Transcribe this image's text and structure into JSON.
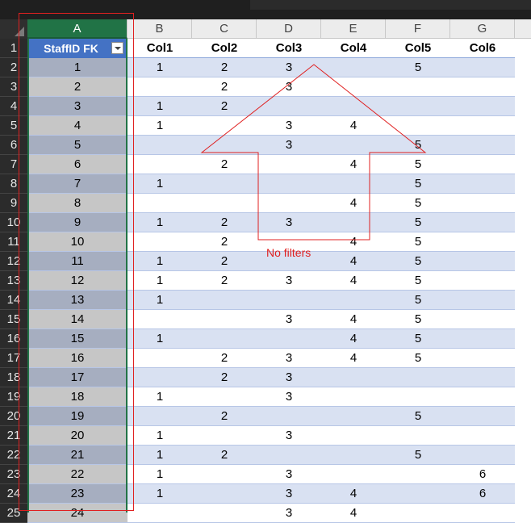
{
  "columns": [
    "A",
    "B",
    "C",
    "D",
    "E",
    "F",
    "G"
  ],
  "headers": [
    "StaffID FK",
    "Col1",
    "Col2",
    "Col3",
    "Col4",
    "Col5",
    "Col6"
  ],
  "row_numbers": [
    "1",
    "2",
    "3",
    "4",
    "5",
    "6",
    "7",
    "8",
    "9",
    "10",
    "11",
    "12",
    "13",
    "14",
    "15",
    "16",
    "17",
    "18",
    "19",
    "20",
    "21",
    "22",
    "23",
    "24",
    "25"
  ],
  "rows": [
    [
      "1",
      "1",
      "2",
      "3",
      "",
      "5",
      ""
    ],
    [
      "2",
      "",
      "2",
      "3",
      "",
      "",
      ""
    ],
    [
      "3",
      "1",
      "2",
      "",
      "",
      "",
      ""
    ],
    [
      "4",
      "1",
      "",
      "3",
      "4",
      "",
      ""
    ],
    [
      "5",
      "",
      "",
      "3",
      "",
      "5",
      ""
    ],
    [
      "6",
      "",
      "2",
      "",
      "4",
      "5",
      ""
    ],
    [
      "7",
      "1",
      "",
      "",
      "",
      "5",
      ""
    ],
    [
      "8",
      "",
      "",
      "",
      "4",
      "5",
      ""
    ],
    [
      "9",
      "1",
      "2",
      "3",
      "",
      "5",
      ""
    ],
    [
      "10",
      "",
      "2",
      "",
      "4",
      "5",
      ""
    ],
    [
      "11",
      "1",
      "2",
      "",
      "4",
      "5",
      ""
    ],
    [
      "12",
      "1",
      "2",
      "3",
      "4",
      "5",
      ""
    ],
    [
      "13",
      "1",
      "",
      "",
      "",
      "5",
      ""
    ],
    [
      "14",
      "",
      "",
      "3",
      "4",
      "5",
      ""
    ],
    [
      "15",
      "1",
      "",
      "",
      "4",
      "5",
      ""
    ],
    [
      "16",
      "",
      "2",
      "3",
      "4",
      "5",
      ""
    ],
    [
      "17",
      "",
      "2",
      "3",
      "",
      "",
      ""
    ],
    [
      "18",
      "1",
      "",
      "3",
      "",
      "",
      ""
    ],
    [
      "19",
      "",
      "2",
      "",
      "",
      "5",
      ""
    ],
    [
      "20",
      "1",
      "",
      "3",
      "",
      "",
      ""
    ],
    [
      "21",
      "1",
      "2",
      "",
      "",
      "5",
      ""
    ],
    [
      "22",
      "1",
      "",
      "3",
      "",
      "",
      "6"
    ],
    [
      "23",
      "1",
      "",
      "3",
      "4",
      "",
      "6"
    ],
    [
      "24",
      "",
      "",
      "3",
      "4",
      "",
      ""
    ]
  ],
  "annotation": "No filters",
  "colors": {
    "selected_header": "#217346",
    "table_header": "#4472c4",
    "band": "#d9e1f2",
    "annotation": "#e02020"
  },
  "icons": {
    "filter": "filter-dropdown-icon",
    "arrow": "up-arrow-annotation"
  }
}
